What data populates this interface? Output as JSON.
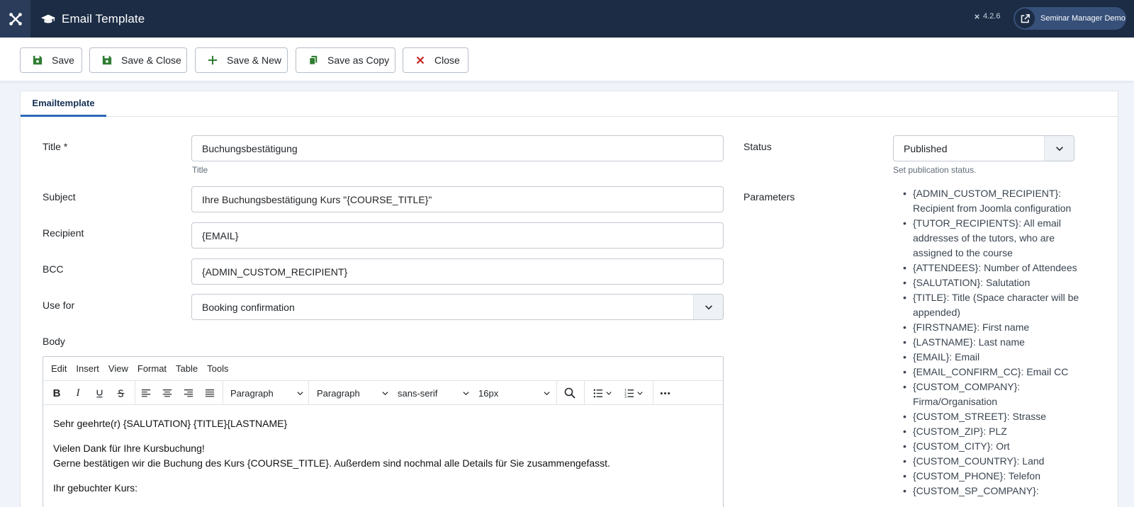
{
  "header": {
    "title": "Email Template",
    "version": "4.2.6",
    "user": "Seminar Manager Demo"
  },
  "toolbar": {
    "save": "Save",
    "save_close": "Save & Close",
    "save_new": "Save & New",
    "save_copy": "Save as Copy",
    "close": "Close"
  },
  "tabs": {
    "emailtemplate": "Emailtemplate"
  },
  "form": {
    "title_label": "Title *",
    "title_value": "Buchungsbestätigung",
    "title_help": "Title",
    "subject_label": "Subject",
    "subject_value": "Ihre Buchungsbestätigung Kurs \"{COURSE_TITLE}\"",
    "recipient_label": "Recipient",
    "recipient_value": "{EMAIL}",
    "bcc_label": "BCC",
    "bcc_value": "{ADMIN_CUSTOM_RECIPIENT}",
    "usefor_label": "Use for",
    "usefor_value": "Booking confirmation",
    "body_label": "Body",
    "status_label": "Status",
    "status_value": "Published",
    "status_help": "Set publication status.",
    "params_label": "Parameters"
  },
  "editor": {
    "menu": [
      "Edit",
      "Insert",
      "View",
      "Format",
      "Table",
      "Tools"
    ],
    "block_format": "Paragraph",
    "style_format": "Paragraph",
    "font_family": "sans-serif",
    "font_size": "16px",
    "body": {
      "line1": "Sehr geehrte(r) {SALUTATION} {TITLE}{LASTNAME}",
      "line2": "Vielen Dank für Ihre Kursbuchung!",
      "line3": "Gerne bestätigen wir die Buchung des Kurs {COURSE_TITLE}. Außerdem sind nochmal alle Details für Sie zusammengefasst.",
      "line4": "Ihr gebuchter Kurs:"
    }
  },
  "parameters": [
    "{ADMIN_CUSTOM_RECIPIENT}: Recipient from Joomla configuration",
    "{TUTOR_RECIPIENTS}: All email addresses of the tutors, who are assigned to the course",
    "{ATTENDEES}: Number of Attendees",
    "{SALUTATION}: Salutation",
    "{TITLE}: Title (Space character will be appended)",
    "{FIRSTNAME}: First name",
    "{LASTNAME}: Last name",
    "{EMAIL}: Email",
    "{EMAIL_CONFIRM_CC}: Email CC",
    "{CUSTOM_COMPANY}: Firma/Organisation",
    "{CUSTOM_STREET}: Strasse",
    "{CUSTOM_ZIP}: PLZ",
    "{CUSTOM_CITY}: Ort",
    "{CUSTOM_COUNTRY}: Land",
    "{CUSTOM_PHONE}: Telefon",
    "{CUSTOM_SP_COMPANY}:"
  ],
  "colors": {
    "header_bg": "#1c2c45",
    "save_green": "#2f7d32",
    "close_red": "#c52827",
    "tab_accent": "#2a69b8"
  }
}
